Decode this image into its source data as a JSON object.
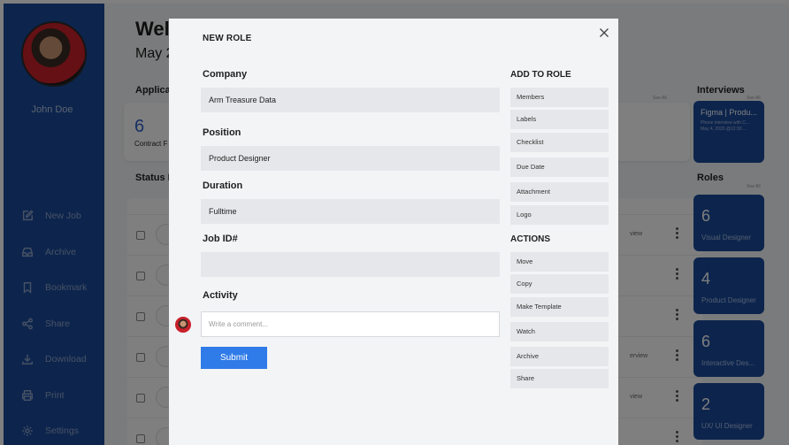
{
  "background": {
    "user_name": "John Doe",
    "nav": [
      {
        "label": "New Job",
        "icon": "edit-icon"
      },
      {
        "label": "Archive",
        "icon": "inbox-icon"
      },
      {
        "label": "Bookmark",
        "icon": "bookmark-icon"
      },
      {
        "label": "Share",
        "icon": "share-icon"
      },
      {
        "label": "Download",
        "icon": "download-icon"
      },
      {
        "label": "Print",
        "icon": "printer-icon"
      },
      {
        "label": "Settings",
        "icon": "gear-icon"
      }
    ],
    "welcome": "Welc",
    "date": "May 2",
    "applications_label": "Applicati",
    "applications_see_all": "See All",
    "stat_number": "6",
    "stat_label": "Contract F",
    "status_label": "Status B",
    "row_tags": [
      "view",
      "erview",
      "view"
    ],
    "interviews_label": "Interviews",
    "interviews_see_all": "See All",
    "interview_card": {
      "title": "Figma | Produ...",
      "line1": "Phone interview with C...",
      "line2": "May 4, 2020 @12:30 ..."
    },
    "roles_label": "Roles",
    "roles_see_all": "See All",
    "roles": [
      {
        "number": "6",
        "label": "Visual Designer"
      },
      {
        "number": "4",
        "label": "Product Designer"
      },
      {
        "number": "6",
        "label": "Interactive Des..."
      },
      {
        "number": "2",
        "label": "UX/ UI Designer"
      }
    ]
  },
  "modal": {
    "title": "NEW ROLE",
    "company_label": "Company",
    "company_value": "Arm Treasure Data",
    "position_label": "Position",
    "position_value": "Product Designer",
    "duration_label": "Duration",
    "duration_value": "Fulltime",
    "jobid_label": "Job ID#",
    "jobid_value": "",
    "activity_label": "Activity",
    "comment_placeholder": "Write a comment...",
    "submit_label": "Submit",
    "add_to_role_label": "ADD TO ROLE",
    "add_to_role": [
      "Members",
      "Labels",
      "Checklist",
      "Due Date",
      "Attachment",
      "Logo"
    ],
    "actions_label": "ACTIONS",
    "actions": [
      "Move",
      "Copy",
      "Make Template",
      "Watch",
      "Archive",
      "Share"
    ]
  }
}
